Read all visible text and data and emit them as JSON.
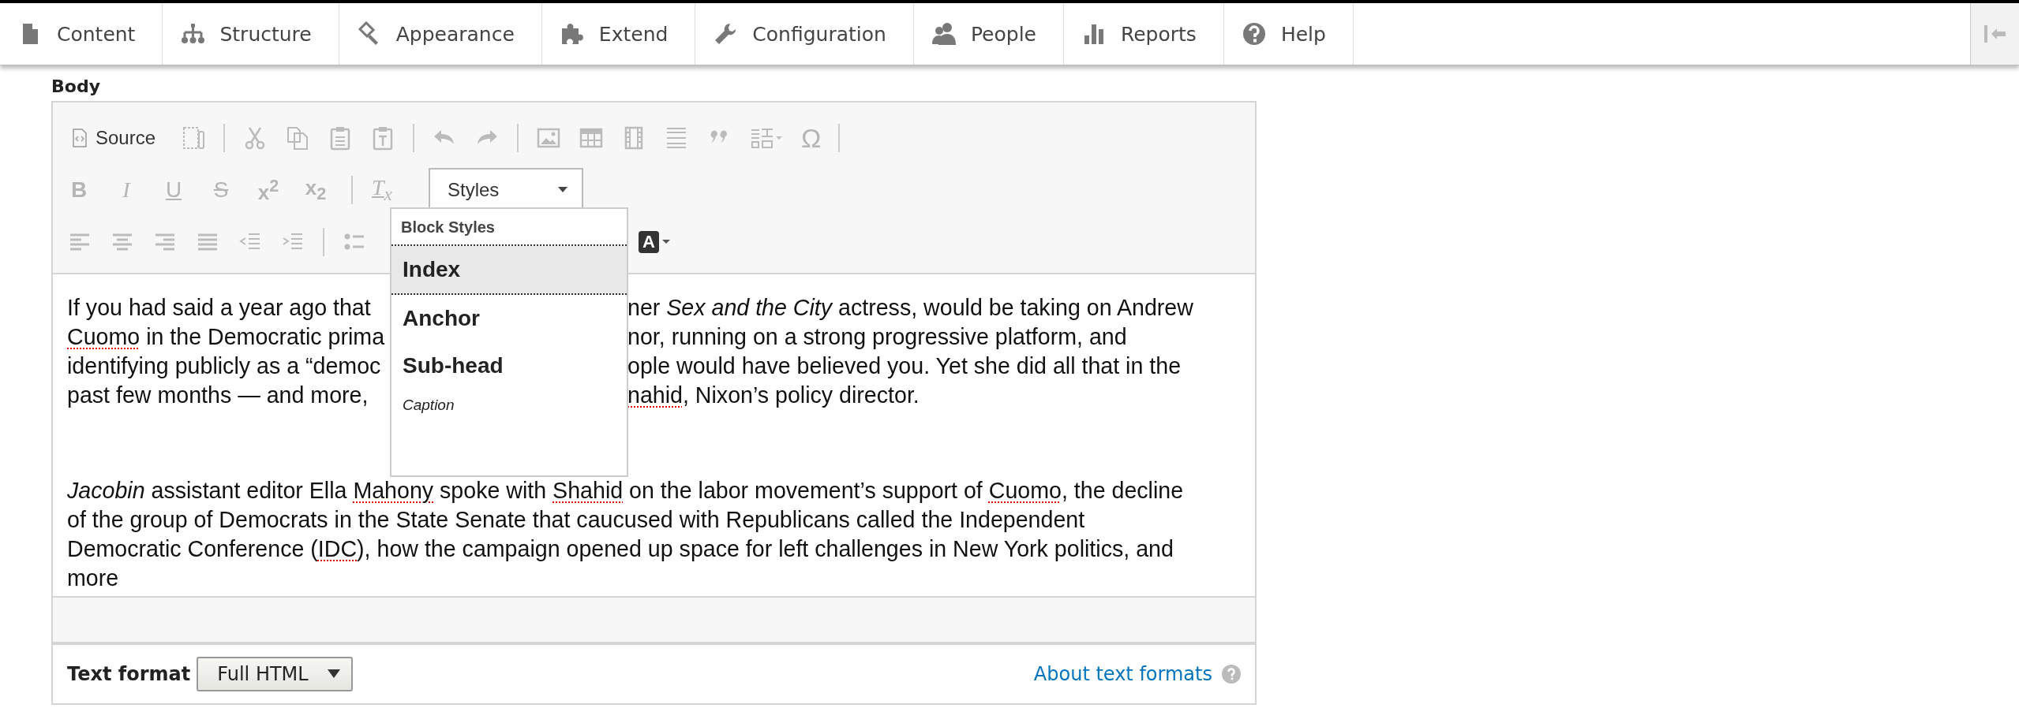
{
  "nav": {
    "items": [
      {
        "label": "Content"
      },
      {
        "label": "Structure"
      },
      {
        "label": "Appearance"
      },
      {
        "label": "Extend"
      },
      {
        "label": "Configuration"
      },
      {
        "label": "People"
      },
      {
        "label": "Reports"
      },
      {
        "label": "Help"
      }
    ]
  },
  "field_label": "Body",
  "editor_toolbar": {
    "source": "Source",
    "special_char": "Ω",
    "basic": [
      "B",
      "I",
      "U",
      "S"
    ],
    "superscript": "x$^{2}$",
    "subscript": "x$_{2}$",
    "remove_format": "T$_{x}$",
    "styles_combo": "Styles",
    "text_color": "A"
  },
  "styles_menu": {
    "header": "Block Styles",
    "items": [
      {
        "label": "Index",
        "kind": "heading",
        "selected": true
      },
      {
        "label": "Anchor",
        "kind": "heading",
        "selected": false
      },
      {
        "label": "Sub-head",
        "kind": "heading",
        "selected": false
      },
      {
        "label": "Caption",
        "kind": "caption",
        "selected": false
      }
    ]
  },
  "paragraphs": [
    {
      "lines": [
        {
          "segments": [
            [
              {
                "text": "If you had said a year ago that",
                "kind": "plain"
              }
            ],
            [
              {
                "text": "ner ",
                "kind": "plain"
              },
              {
                "text": "Sex and the City",
                "kind": "italic"
              },
              {
                "text": " actress, would be taking on Andrew",
                "kind": "plain"
              }
            ]
          ]
        },
        {
          "segments": [
            [
              {
                "text": "Cuomo",
                "kind": "misspelled"
              },
              {
                "text": " in the Democratic prima",
                "kind": "plain"
              }
            ],
            [
              {
                "text": "nor, running on a strong progressive platform, and",
                "kind": "plain"
              }
            ]
          ]
        },
        {
          "segments": [
            [
              {
                "text": "identifying publicly as a “democ",
                "kind": "plain"
              }
            ],
            [
              {
                "text": "ople would have believed you. Yet she did all that in the",
                "kind": "plain"
              }
            ]
          ]
        },
        {
          "segments": [
            [
              {
                "text": "past few months — and more,",
                "kind": "plain"
              }
            ],
            [
              {
                "text": "nahid",
                "kind": "misspelled"
              },
              {
                "text": ", Nixon’s policy director.",
                "kind": "plain"
              }
            ]
          ]
        }
      ]
    },
    {
      "lines": [
        {
          "segments": [
            [
              {
                "text": "Jacobin",
                "kind": "italic"
              },
              {
                "text": " assistant editor Ella ",
                "kind": "plain"
              },
              {
                "text": "Mahony",
                "kind": "misspelled"
              },
              {
                "text": " spoke with ",
                "kind": "plain"
              },
              {
                "text": "Shahid",
                "kind": "misspelled"
              },
              {
                "text": " on the labor movement’s support of ",
                "kind": "plain"
              },
              {
                "text": "Cuomo",
                "kind": "misspelled"
              },
              {
                "text": ", the decline",
                "kind": "plain"
              }
            ]
          ]
        },
        {
          "segments": [
            [
              {
                "text": "of the group of Democrats in the State Senate that caucused with Republicans called the Independent",
                "kind": "plain"
              }
            ]
          ]
        },
        {
          "segments": [
            [
              {
                "text": "Democratic Conference (",
                "kind": "plain"
              },
              {
                "text": "IDC",
                "kind": "misspelled"
              },
              {
                "text": "), how the campaign opened up space for left challenges in New York politics, and",
                "kind": "plain"
              }
            ]
          ]
        },
        {
          "segments": [
            [
              {
                "text": "more",
                "kind": "plain"
              }
            ]
          ]
        }
      ]
    }
  ],
  "footer": {
    "label": "Text format",
    "select_value": "Full HTML",
    "link": "About text formats"
  }
}
